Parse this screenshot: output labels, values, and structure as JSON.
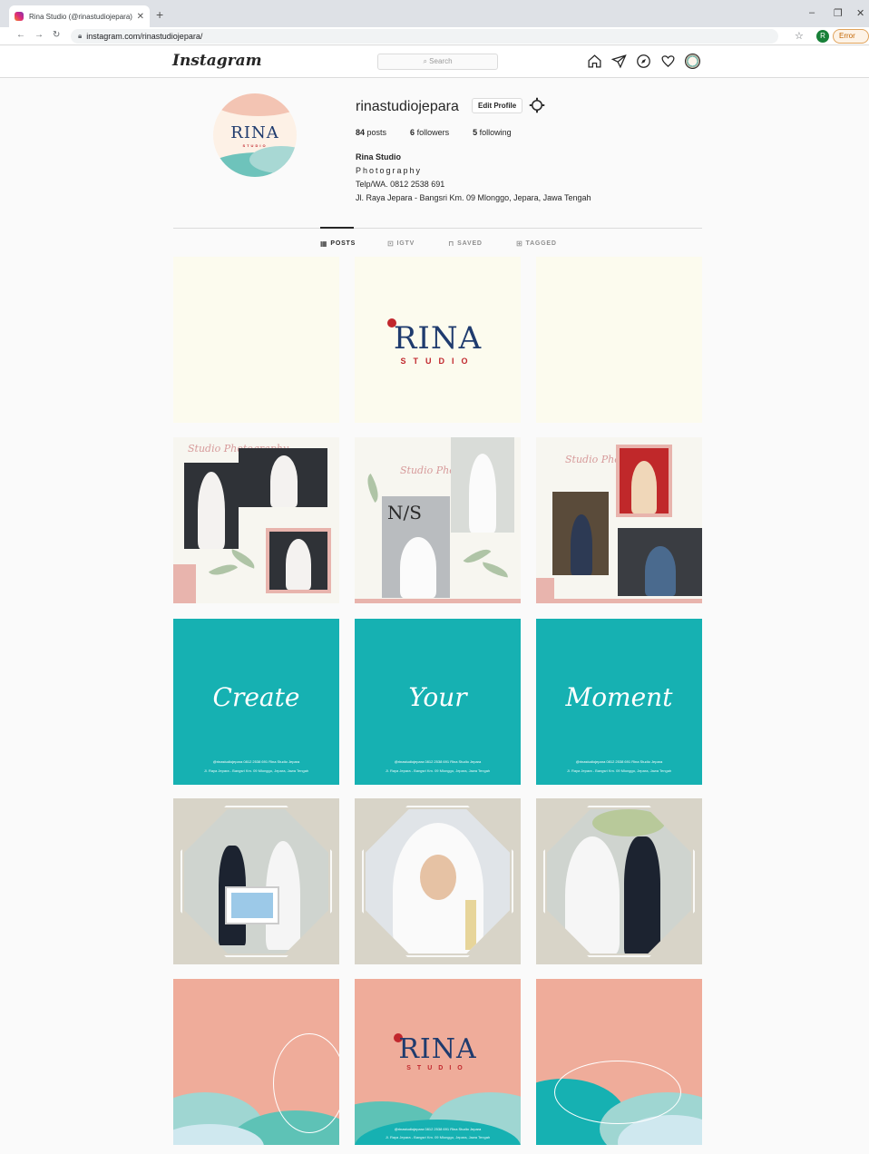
{
  "browser": {
    "tab_title": "Rina Studio (@rinastudiojepara) ·",
    "url": "instagram.com/rinastudiojepara/",
    "profile_initial": "R",
    "status_chip": "Error"
  },
  "header": {
    "logo": "Instagram",
    "search_placeholder": "Search"
  },
  "profile": {
    "avatar_brand": "RINA",
    "avatar_sub": "STUDIO",
    "username": "rinastudiojepara",
    "edit_label": "Edit Profile",
    "stats": {
      "posts_count": "84",
      "posts_label": "posts",
      "followers_count": "6",
      "followers_label": "followers",
      "following_count": "5",
      "following_label": "following"
    },
    "bio": {
      "name": "Rina Studio",
      "line1": "Photography",
      "line2": "Telp/WA. 0812 2538 691",
      "line3": "Jl. Raya Jepara - Bangsri Km. 09 Mlonggo, Jepara, Jawa Tengah"
    }
  },
  "tabs": [
    {
      "label": "POSTS",
      "icon": "grid-icon"
    },
    {
      "label": "IGTV",
      "icon": "igtv-icon"
    },
    {
      "label": "SAVED",
      "icon": "bookmark-icon"
    },
    {
      "label": "TAGGED",
      "icon": "tag-icon"
    }
  ],
  "grid": {
    "brand": "RINA",
    "brand_sub": "STUDIO",
    "script_label": "Studio Photography",
    "ns_mark": "N/S",
    "words": [
      "Create",
      "Your",
      "Moment"
    ],
    "footer_contacts": "@rinastudiojepara   0812 2538 691   Rina Studio Jepara",
    "footer_address": "Jl. Raya Jepara - Bangsri Km. 09 Mlonggo, Jepara, Jawa Tengah"
  },
  "colors": {
    "teal": "#16b1b2",
    "salmon": "#efac9a",
    "navy": "#1f3b6e",
    "red": "#c1272d"
  }
}
